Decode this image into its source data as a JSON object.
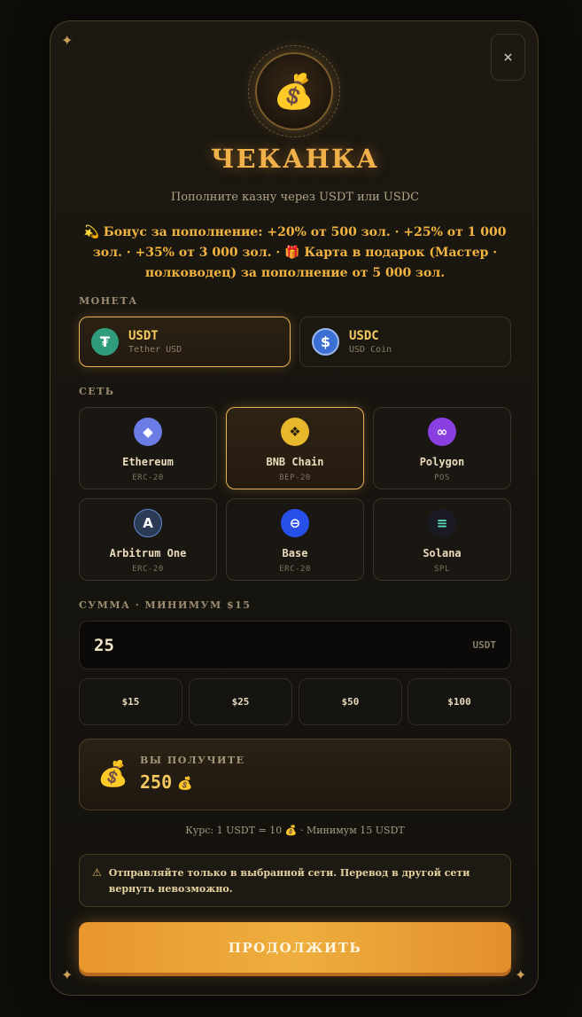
{
  "close_label": "×",
  "emblem_icon": "💰",
  "title": "ЧЕКАНКА",
  "subtitle": "Пополните казну через USDT или USDC",
  "bonus_text": "💫 Бонус за пополнение: +20% от 500 зол. · +25% от 1 000 зол. · +35% от 3 000 зол. · 🎁 Карта в подарок (Мастер · полководец) за пополнение от 5 000 зол.",
  "coin_section_label": "МОНЕТА",
  "coins": [
    {
      "name": "USDT",
      "sub": "Tether USD",
      "icon": "₮",
      "color": "#2f9d7b",
      "selected": true
    },
    {
      "name": "USDC",
      "sub": "USD Coin",
      "icon": "$",
      "color": "#3b6fd4",
      "selected": false
    }
  ],
  "network_section_label": "СЕТЬ",
  "networks": [
    {
      "name": "Ethereum",
      "std": "ERC-20",
      "icon": "◆",
      "color": "#6c7ce6"
    },
    {
      "name": "BNB Chain",
      "std": "BEP-20",
      "icon": "❖",
      "color": "#e8b82c"
    },
    {
      "name": "Polygon",
      "std": "POS",
      "icon": "∞",
      "color": "#8a3fe0"
    },
    {
      "name": "Arbitrum One",
      "std": "ERC-20",
      "icon": "A",
      "color": "#2b3a55"
    },
    {
      "name": "Base",
      "std": "ERC-20",
      "icon": "⊖",
      "color": "#2750e8"
    },
    {
      "name": "Solana",
      "std": "SPL",
      "icon": "≡",
      "color": "#1a1a24"
    }
  ],
  "selected_network": "BNB Chain",
  "amount_section_label": "СУММА · МИНИМУМ $15",
  "amount_value": "25",
  "amount_unit": "USDT",
  "presets": [
    "$15",
    "$25",
    "$50",
    "$100"
  ],
  "receive_label": "ВЫ ПОЛУЧИТЕ",
  "receive_value": "250",
  "receive_icon": "💰",
  "rate_text": "Курс: 1 USDT = 10 💰 · Минимум 15 USDT",
  "warning_icon": "⚠",
  "warning_text": "Отправляйте только в выбранной сети. Перевод в другой сети вернуть невозможно.",
  "continue_label": "ПРОДОЛЖИТЬ",
  "colors": {
    "accent": "#f0b04a",
    "button": "#eeae3e",
    "selected_border": "#e6b452"
  }
}
